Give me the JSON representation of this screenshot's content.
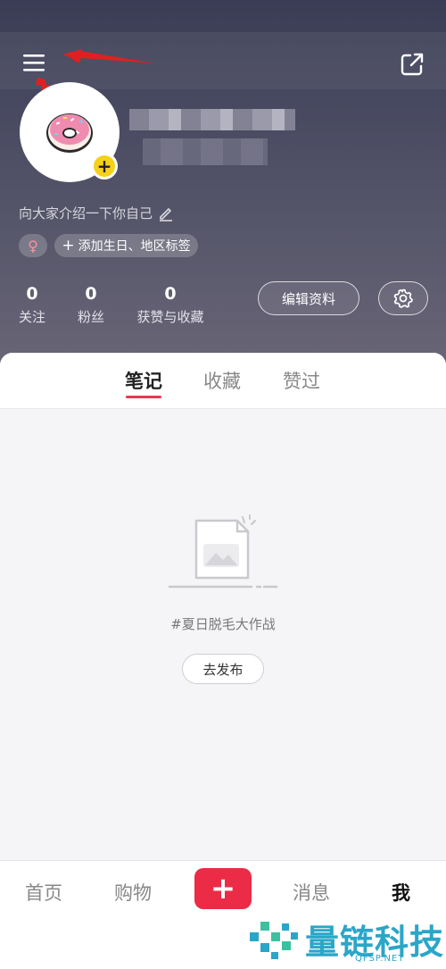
{
  "profile": {
    "bio": "向大家介绍一下你自己",
    "gender_symbol": "♀",
    "add_tag_label": "添加生日、地区标签",
    "stats": [
      {
        "num": "0",
        "label": "关注"
      },
      {
        "num": "0",
        "label": "粉丝"
      },
      {
        "num": "0",
        "label": "获赞与收藏"
      }
    ],
    "edit_label": "编辑资料"
  },
  "tabs": [
    "笔记",
    "收藏",
    "赞过"
  ],
  "empty": {
    "text": "#夏日脱毛大作战",
    "button": "去发布"
  },
  "nav": {
    "items": [
      "首页",
      "购物",
      "消息",
      "我"
    ],
    "plus": "+"
  },
  "watermark": {
    "text": "量链科技",
    "sub": "QFSP.NET"
  },
  "colors": {
    "accent": "#ec2b46",
    "badge": "#f6d11b",
    "watermark": "#2aa6c8"
  }
}
